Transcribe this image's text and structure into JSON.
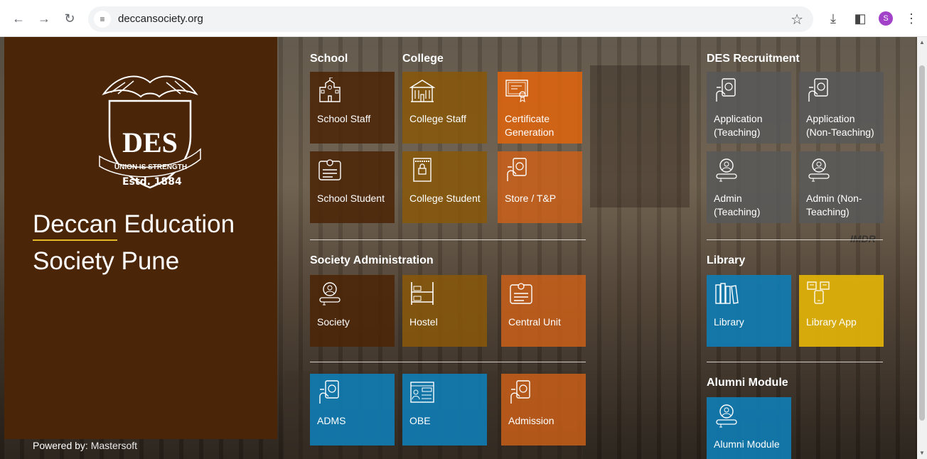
{
  "browser": {
    "url": "deccansociety.org",
    "avatar_letter": "S"
  },
  "brand": {
    "title_line1_word1": "Deccan",
    "title_line1_word2": " Education",
    "title_line2": "Society Pune",
    "crest_motto": "UNION IS STRENGTH",
    "crest_estd": "Estd. 1884",
    "crest_letters": "DES",
    "powered_label": "Powered by:",
    "powered_name": "Mastersoft"
  },
  "sections": {
    "school": "School",
    "college": "College",
    "society_admin": "Society Administration",
    "recruitment": "DES Recruitment",
    "library": "Library",
    "alumni": "Alumni Module"
  },
  "tiles": {
    "school_staff": "School Staff",
    "college_staff": "College Staff",
    "certificate": "Certificate Generation",
    "school_student": "School Student",
    "college_student": "College Student",
    "store": "Store / T&P",
    "society": "Society",
    "hostel": "Hostel",
    "central_unit": "Central Unit",
    "adms": "ADMS",
    "obe": "OBE",
    "admission": "Admission",
    "app_teaching": "Application (Teaching)",
    "app_nonteaching": "Application (Non-Teaching)",
    "admin_teaching": "Admin (Teaching)",
    "admin_nonteaching": "Admin (Non-Teaching)",
    "library": "Library",
    "library_app": "Library App",
    "alumni_module": "Alumni Module"
  },
  "background_sign": "IMDR",
  "colors": {
    "brand_panel": "#4a2507",
    "accent_underline": "#e0b828",
    "tile_blue": "#107cb2",
    "tile_orange": "#de640e",
    "tile_yellow": "#deb00a"
  }
}
